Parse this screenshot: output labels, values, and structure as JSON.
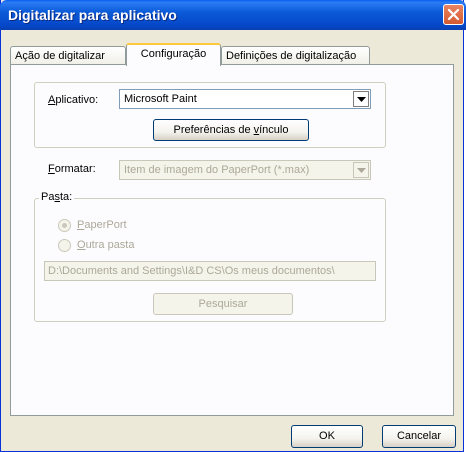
{
  "window": {
    "title": "Digitalizar para aplicativo",
    "close_icon": "close-icon"
  },
  "tabs": [
    {
      "label": "Ação de digitalizar",
      "active": false
    },
    {
      "label": "Configuração",
      "active": true
    },
    {
      "label": "Definições de digitalização",
      "active": false
    }
  ],
  "app_group": {
    "label_pre": "",
    "label_accel": "A",
    "label_post": "plicativo:",
    "value": "Microsoft Paint",
    "prefs_button_pre": "Preferências de ",
    "prefs_button_accel": "v",
    "prefs_button_post": "ínculo"
  },
  "format": {
    "label_accel": "F",
    "label_post": "ormatar:",
    "value": "Item de imagem do PaperPort (*.max)"
  },
  "folder_group": {
    "legend_pre": "Pa",
    "legend_accel": "s",
    "legend_post": "ta:",
    "radio_paperport_accel": "P",
    "radio_paperport_post": "aperPort",
    "radio_paperport_selected": true,
    "radio_other_accel": "O",
    "radio_other_post": "utra pasta",
    "path": "D:\\Documents and Settings\\I&D CS\\Os meus documentos\\",
    "browse_button": "Pesquisar"
  },
  "footer": {
    "ok": "OK",
    "cancel": "Cancelar"
  }
}
